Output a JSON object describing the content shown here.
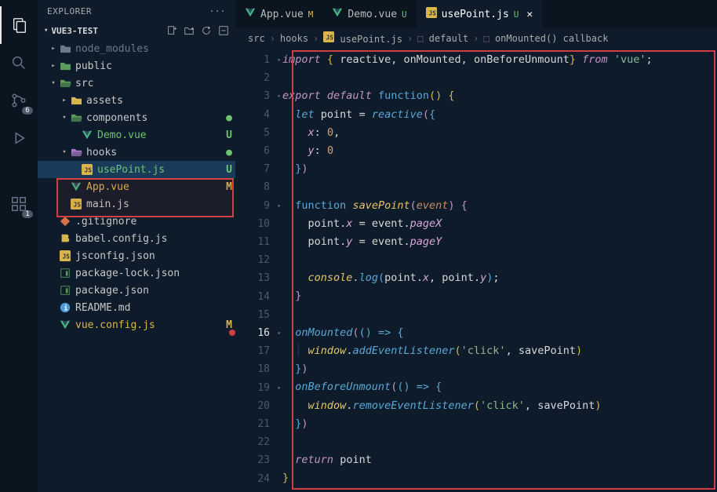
{
  "activity": {
    "badge_scm": "6",
    "badge_ext": "1"
  },
  "sidebar": {
    "title": "EXPLORER",
    "project": "VUE3-TEST"
  },
  "tree": [
    {
      "indent": 1,
      "chev": ">",
      "iconColor": "#6a7a8a",
      "iconType": "folder",
      "label": "node_modules",
      "cls": "dim"
    },
    {
      "indent": 1,
      "chev": ">",
      "iconColor": "#5a9a5a",
      "iconType": "folder",
      "label": "public"
    },
    {
      "indent": 1,
      "chev": "v",
      "iconColor": "#5a9a5a",
      "iconType": "folder-open",
      "label": "src"
    },
    {
      "indent": 2,
      "chev": ">",
      "iconColor": "#d8b64c",
      "iconType": "folder",
      "label": "assets"
    },
    {
      "indent": 2,
      "chev": "v",
      "iconColor": "#5a9a5a",
      "iconType": "folder-open",
      "label": "components",
      "dot": "●",
      "dotCls": "green"
    },
    {
      "indent": 3,
      "chev": "",
      "iconColor": "#42b883",
      "iconType": "vue",
      "label": "Demo.vue",
      "status": "U",
      "statusCls": "green",
      "labelCls": "green"
    },
    {
      "indent": 2,
      "chev": "v",
      "iconColor": "#a878c8",
      "iconType": "folder-open",
      "label": "hooks",
      "dot": "●",
      "dotCls": "green"
    },
    {
      "indent": 3,
      "chev": "",
      "iconColor": "#d8b64c",
      "iconType": "js",
      "label": "usePoint.js",
      "status": "U",
      "statusCls": "green",
      "labelCls": "green",
      "selected": true
    },
    {
      "indent": 2,
      "chev": "",
      "iconColor": "#42b883",
      "iconType": "vue",
      "label": "App.vue",
      "status": "M",
      "statusCls": "yellow",
      "labelCls": "yellow"
    },
    {
      "indent": 2,
      "chev": "",
      "iconColor": "#d8b64c",
      "iconType": "js",
      "label": "main.js"
    },
    {
      "indent": 1,
      "chev": "",
      "iconColor": "#d87048",
      "iconType": "git",
      "label": ".gitignore"
    },
    {
      "indent": 1,
      "chev": "",
      "iconColor": "#d8b64c",
      "iconType": "babel",
      "label": "babel.config.js"
    },
    {
      "indent": 1,
      "chev": "",
      "iconColor": "#d8b64c",
      "iconType": "js",
      "label": "jsconfig.json"
    },
    {
      "indent": 1,
      "chev": "",
      "iconColor": "#5a9a5a",
      "iconType": "npm",
      "label": "package-lock.json"
    },
    {
      "indent": 1,
      "chev": "",
      "iconColor": "#5a9a5a",
      "iconType": "npm",
      "label": "package.json"
    },
    {
      "indent": 1,
      "chev": "",
      "iconColor": "#4a9ad8",
      "iconType": "info",
      "label": "README.md"
    },
    {
      "indent": 1,
      "chev": "",
      "iconColor": "#42b883",
      "iconType": "vue",
      "label": "vue.config.js",
      "status": "M",
      "statusCls": "yellow",
      "labelCls": "yellow"
    }
  ],
  "tabs": [
    {
      "icon": "vue",
      "label": "App.vue",
      "status": "M",
      "statusCls": "yellow"
    },
    {
      "icon": "vue",
      "label": "Demo.vue",
      "status": "U",
      "statusCls": "green"
    },
    {
      "icon": "js",
      "label": "usePoint.js",
      "status": "U",
      "statusCls": "green",
      "active": true,
      "close": true
    }
  ],
  "breadcrumbs": {
    "parts": [
      "src",
      "hooks",
      "usePoint.js",
      "default",
      "onMounted() callback"
    ]
  },
  "code": {
    "lines": 24,
    "currentLine": 16
  }
}
